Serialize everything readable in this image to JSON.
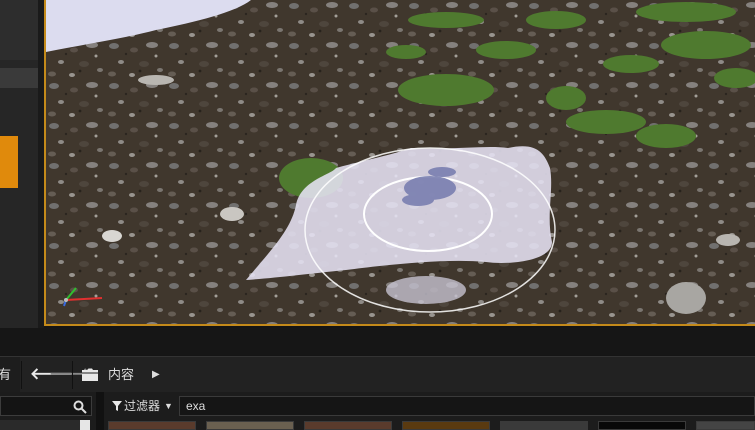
{
  "left_panel": {
    "accent_color": "#e08a0c"
  },
  "viewport": {
    "border_color": "#c48a1a"
  },
  "content_browser": {
    "left_tab_text": "有",
    "nav_back_glyph": "🡐",
    "nav_forward_glyph": "🡒",
    "path_root": "内容",
    "path_arrow": "▶",
    "filter_label": "过滤器",
    "filter_caret": "▼",
    "search_value": "exa"
  },
  "icons": [
    "folder-icon",
    "search-icon",
    "filter-icon",
    "back-arrow-icon",
    "forward-arrow-icon",
    "axis-gizmo-icon",
    "brush-radius-icon"
  ],
  "thumbnails": [
    {
      "name": "thumb-1",
      "color": "#5a3b2c"
    },
    {
      "name": "thumb-2",
      "color": "#6a6050"
    },
    {
      "name": "thumb-3",
      "color": "#5a3b2c"
    },
    {
      "name": "thumb-4",
      "color": "#5a3a10"
    },
    {
      "name": "thumb-5",
      "color": "#3a3a3a"
    },
    {
      "name": "thumb-6",
      "color": "#080808"
    },
    {
      "name": "thumb-7",
      "color": "#444"
    }
  ]
}
